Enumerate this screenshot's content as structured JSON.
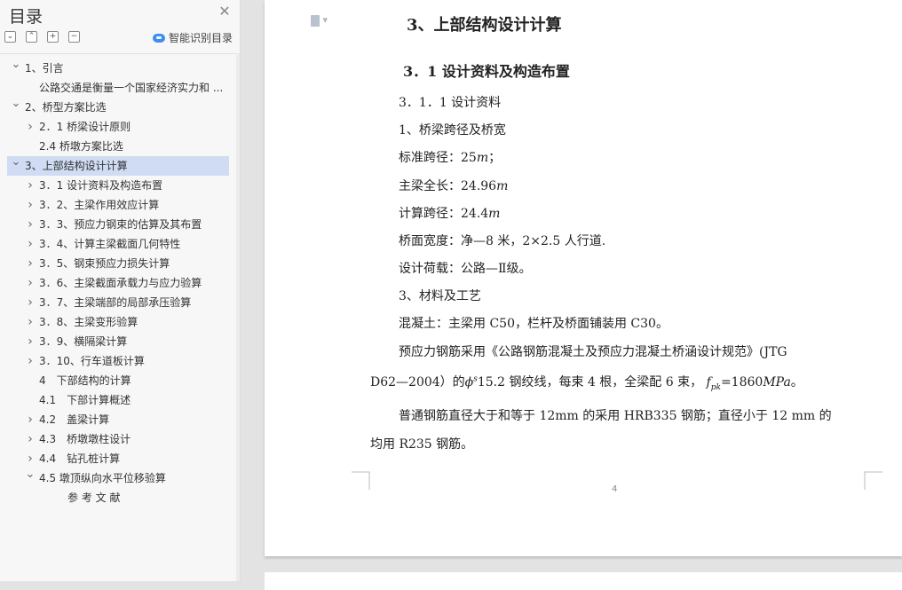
{
  "sidebar": {
    "title": "目录",
    "close_icon": "close-icon",
    "tools": [
      "collapse-all-icon",
      "expand-all-icon",
      "add-heading-icon",
      "remove-heading-icon"
    ],
    "smart_label": "智能识别目录",
    "items": [
      {
        "label": "1、引言",
        "arrow": "v"
      },
      {
        "label": "公路交通是衡量一个国家经济实力和 ...",
        "arrow": ""
      },
      {
        "label": "2、桥型方案比选",
        "arrow": "v"
      },
      {
        "label": "2．1 桥梁设计原则",
        "arrow": ">"
      },
      {
        "label": "2.4 桥墩方案比选",
        "arrow": ""
      },
      {
        "label": "3、上部结构设计计算",
        "arrow": "v"
      },
      {
        "label": "3．1 设计资料及构造布置",
        "arrow": ">"
      },
      {
        "label": "3．2、主梁作用效应计算",
        "arrow": ">"
      },
      {
        "label": "3．3、预应力钢束的估算及其布置",
        "arrow": ">"
      },
      {
        "label": "3．4、计算主梁截面几何特性",
        "arrow": ">"
      },
      {
        "label": "3．5、钢束预应力损失计算",
        "arrow": ">"
      },
      {
        "label": "3．6、主梁截面承载力与应力验算",
        "arrow": ">"
      },
      {
        "label": "3．7、主梁端部的局部承压验算",
        "arrow": ">"
      },
      {
        "label": "3．8、主梁变形验算",
        "arrow": ">"
      },
      {
        "label": "3．9、横隔梁计算",
        "arrow": ">"
      },
      {
        "label": "3．10、行车道板计算",
        "arrow": ">"
      },
      {
        "label": "4　下部结构的计算",
        "arrow": ""
      },
      {
        "label": "4.1　下部计算概述",
        "arrow": ""
      },
      {
        "label": "4.2　盖梁计算",
        "arrow": ">"
      },
      {
        "label": "4.3　桥墩墩柱设计",
        "arrow": ">"
      },
      {
        "label": "4.4　钻孔桩计算",
        "arrow": ">"
      },
      {
        "label": "4.5 墩顶纵向水平位移验算",
        "arrow": "v"
      },
      {
        "label": "参 考 文 献",
        "arrow": ""
      }
    ]
  },
  "document": {
    "heading1": "3、上部结构设计计算",
    "heading2": "3．1  设计资料及构造布置",
    "sub": "3．1．1 设计资料",
    "item1": "1、桥梁跨径及桥宽",
    "span_std": "标准跨径：25",
    "span_std_unit": "m",
    "span_std_tail": "；",
    "beam_len": "主梁全长：24.96",
    "beam_len_unit": "m",
    "calc_span": "计算跨径：24.4",
    "calc_span_unit": "m",
    "deck_width": "桥面宽度：净—8 米，2×2.5 人行道.",
    "design_load": "设计荷载：公路—Ⅱ级。",
    "item3": "3、材料及工艺",
    "concrete": "混凝土：主梁用 C50，栏杆及桥面铺装用 C30。",
    "prestress_line1": "预应力钢筋采用《公路钢筋混凝土及预应力混凝土桥涵设计规范》(JTG",
    "prestress_line2a": "D62—2004）的",
    "prestress_phi": "ϕ",
    "prestress_phi_sup": "s",
    "prestress_line2b": "15.2 钢绞线，每束 4 根，全梁配 6 束，",
    "fpk": "f",
    "fpk_sub": "pk",
    "fpk_val": "=1860",
    "fpk_unit": "MPa",
    "fpk_end": "。",
    "rebar_line1": "普通钢筋直径大于和等于 12mm 的采用 HRB335 钢筋；直径小于 12 mm 的",
    "rebar_line2": "均用 R235 钢筋。",
    "page_number": "4"
  }
}
